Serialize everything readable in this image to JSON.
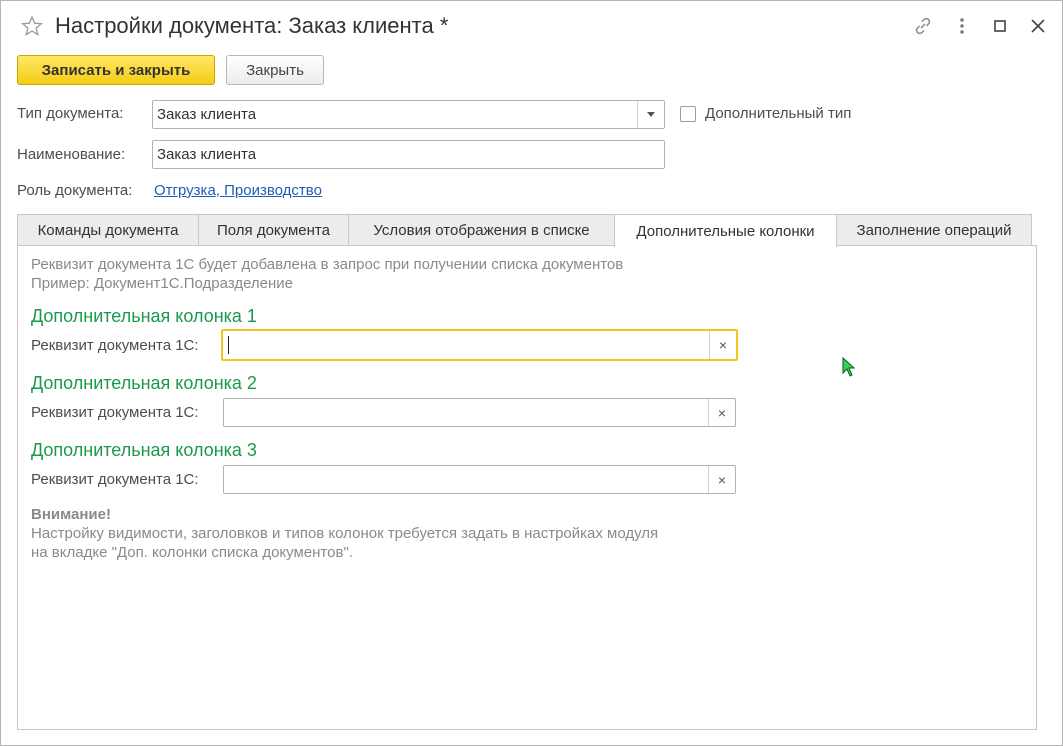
{
  "window": {
    "title": "Настройки документа: Заказ клиента *",
    "icons": [
      "star-icon",
      "link-icon",
      "more-icon",
      "maximize-icon",
      "close-icon"
    ]
  },
  "toolbar": {
    "save_close_label": "Записать и закрыть",
    "close_label": "Закрыть"
  },
  "form": {
    "doc_type_label": "Тип документа:",
    "doc_type_value": "Заказ клиента",
    "additional_type_label": "Дополнительный тип",
    "additional_type_checked": false,
    "name_label": "Наименование:",
    "name_value": "Заказ клиента",
    "role_label": "Роль документа:",
    "role_value": "Отгрузка, Производство"
  },
  "tabs": [
    {
      "label": "Команды документа",
      "active": false
    },
    {
      "label": "Поля документа",
      "active": false
    },
    {
      "label": "Условия отображения в списке",
      "active": false
    },
    {
      "label": "Дополнительные колонки",
      "active": true
    },
    {
      "label": "Заполнение операций",
      "active": false
    }
  ],
  "panel": {
    "hint_line1": "Реквизит документа 1С будет добавлена в запрос при получении списка документов",
    "hint_line2": "Пример: Документ1С.Подразделение",
    "columns": [
      {
        "title": "Дополнительная колонка 1",
        "field_label": "Реквизит документа 1С:",
        "value": ""
      },
      {
        "title": "Дополнительная колонка 2",
        "field_label": "Реквизит документа 1С:",
        "value": ""
      },
      {
        "title": "Дополнительная колонка 3",
        "field_label": "Реквизит документа 1С:",
        "value": ""
      }
    ],
    "clear_symbol": "×",
    "warning_title": "Внимание!",
    "warning_line1": "Настройку видимости, заголовков и типов колонок требуется задать в настройках модуля",
    "warning_line2": "на вкладке \"Доп. колонки списка документов\"."
  },
  "colors": {
    "primary_button": "#f5cc14",
    "section_title": "#1a9a4a",
    "link": "#1c5fb8",
    "focus_border": "#f2c521"
  }
}
